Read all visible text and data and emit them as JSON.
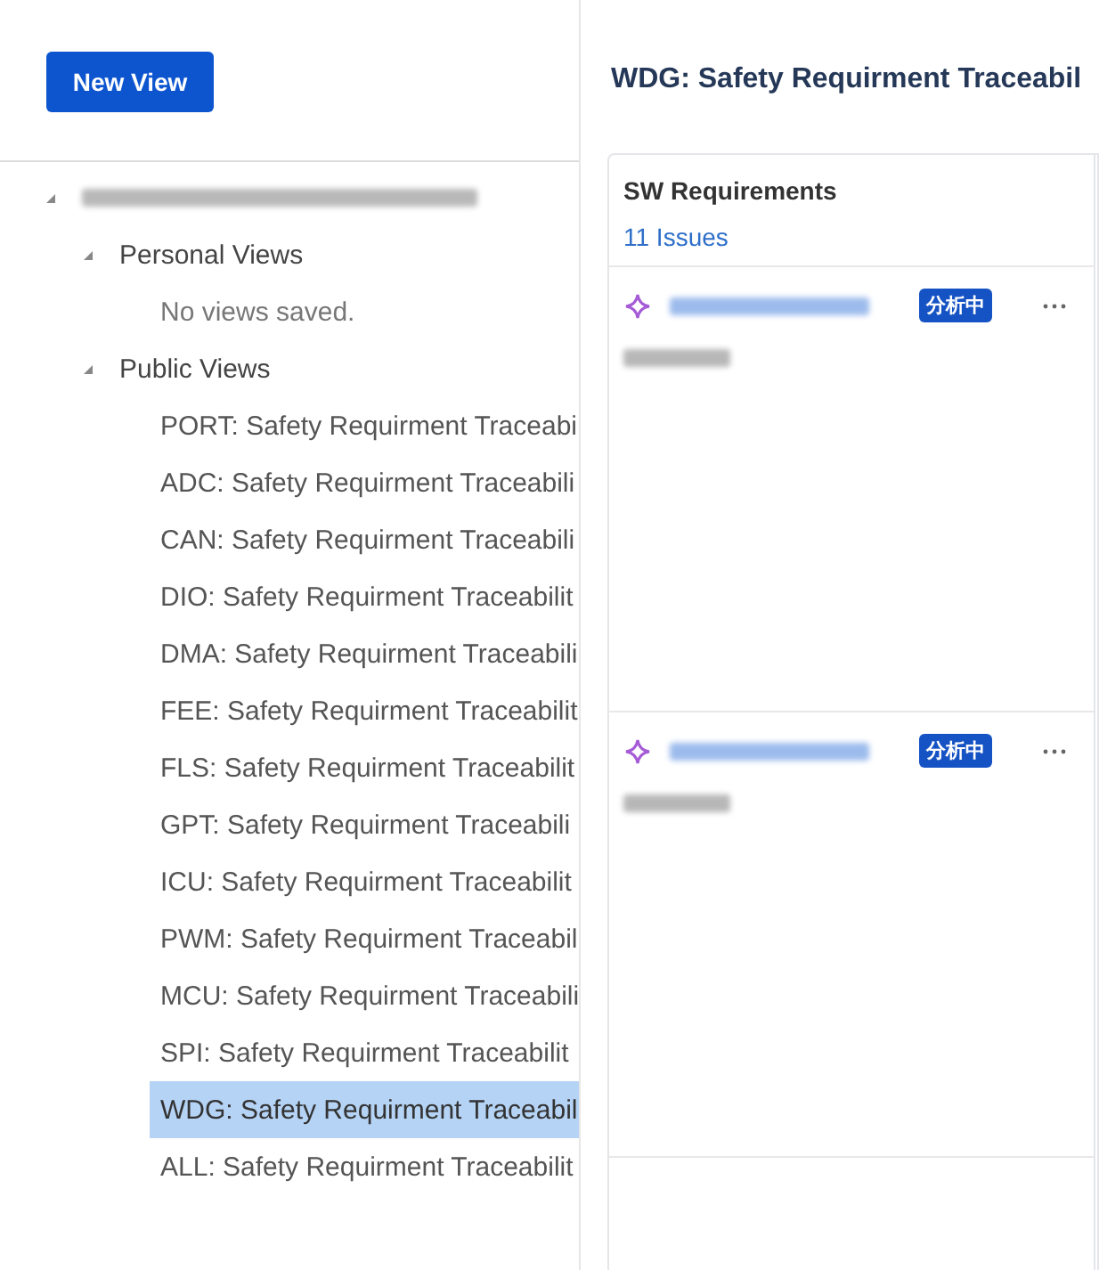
{
  "new_view_button": "New View",
  "tree": [
    {
      "kind": "redacted",
      "expanded": true,
      "children": [
        {
          "label": "Personal Views",
          "expanded": true,
          "empty_message": "No views saved."
        },
        {
          "label": "Public Views",
          "expanded": true,
          "views": [
            {
              "label": "PORT: Safety Requirment Traceabi",
              "selected": false
            },
            {
              "label": "ADC: Safety Requirment Traceabili",
              "selected": false
            },
            {
              "label": "CAN: Safety Requirment Traceabili",
              "selected": false
            },
            {
              "label": "DIO: Safety Requirment Traceabilit",
              "selected": false
            },
            {
              "label": "DMA: Safety Requirment Traceabili",
              "selected": false
            },
            {
              "label": "FEE: Safety Requirment Traceabilit",
              "selected": false
            },
            {
              "label": "FLS: Safety Requirment Traceabilit",
              "selected": false
            },
            {
              "label": "GPT: Safety Requirment Traceabili",
              "selected": false
            },
            {
              "label": "ICU: Safety Requirment Traceabilit",
              "selected": false
            },
            {
              "label": "PWM: Safety Requirment Traceabil",
              "selected": false
            },
            {
              "label": "MCU: Safety Requirment Traceabili",
              "selected": false
            },
            {
              "label": "SPI: Safety Requirment Traceabilit",
              "selected": false
            },
            {
              "label": "WDG: Safety Requirment Traceabil",
              "selected": true
            },
            {
              "label": "ALL: Safety Requirment Traceabilit",
              "selected": false
            }
          ]
        }
      ]
    }
  ],
  "board": {
    "title": "WDG: Safety Requirment Traceabil",
    "columns": [
      {
        "name": "SW Requirements",
        "count": "11 Issues",
        "cards": [
          {
            "summary": {
              "kind": "redacted"
            },
            "key": {
              "kind": "redacted"
            },
            "status": "分析中"
          },
          {
            "summary": {
              "kind": "redacted"
            },
            "key": {
              "kind": "redacted"
            },
            "status": "分析中"
          }
        ]
      }
    ]
  }
}
